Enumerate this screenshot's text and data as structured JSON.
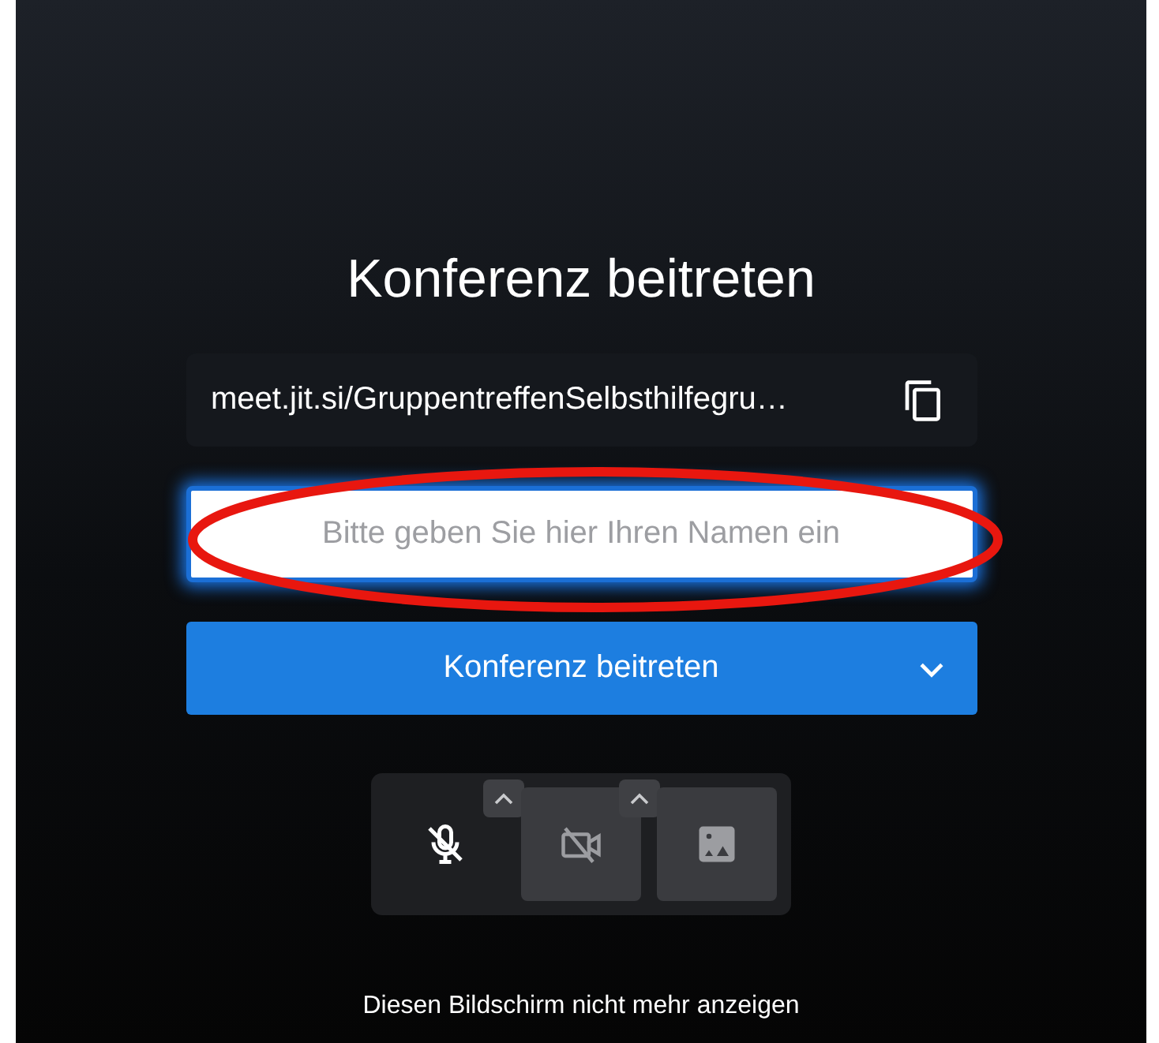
{
  "title": "Konferenz beitreten",
  "meeting_url": {
    "text": "meet.jit.si/GruppentreffenSelbsthilfegru…"
  },
  "name_field": {
    "placeholder": "Bitte geben Sie hier Ihren Namen ein",
    "focused": true
  },
  "join_button": {
    "label": "Konferenz beitreten"
  },
  "toolbar": [
    {
      "kind": "mic",
      "muted": true,
      "disabled": false,
      "has_menu": true
    },
    {
      "kind": "camera",
      "muted": true,
      "disabled": true,
      "has_menu": true
    },
    {
      "kind": "background",
      "muted": false,
      "disabled": true,
      "has_menu": false
    }
  ],
  "footer_link": "Diesen Bildschirm nicht mehr anzeigen"
}
